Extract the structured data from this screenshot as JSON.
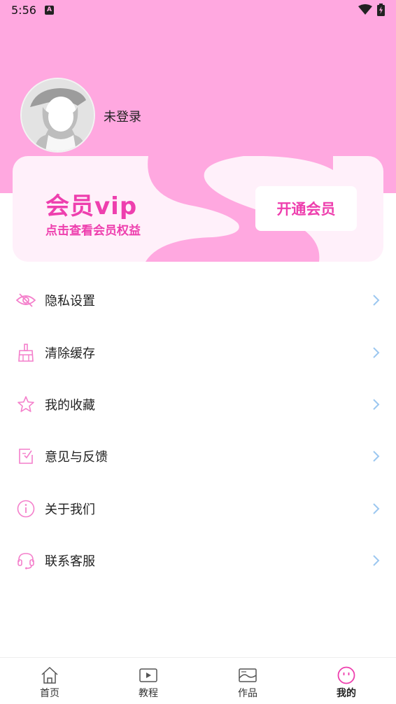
{
  "status_bar": {
    "time": "5:56",
    "notification_letter": "A"
  },
  "profile": {
    "login_status": "未登录"
  },
  "vip_card": {
    "title": "会员vip",
    "subtitle": "点击查看会员权益",
    "button_label": "开通会员"
  },
  "menu": {
    "items": [
      {
        "label": "隐私设置",
        "icon": "eye-icon"
      },
      {
        "label": "清除缓存",
        "icon": "broom-icon"
      },
      {
        "label": "我的收藏",
        "icon": "star-icon"
      },
      {
        "label": "意见与反馈",
        "icon": "feedback-icon"
      },
      {
        "label": "关于我们",
        "icon": "info-icon"
      },
      {
        "label": "联系客服",
        "icon": "headset-icon"
      }
    ]
  },
  "tabs": [
    {
      "label": "首页",
      "icon": "home-icon",
      "active": false
    },
    {
      "label": "教程",
      "icon": "play-icon",
      "active": false
    },
    {
      "label": "作品",
      "icon": "gallery-icon",
      "active": false
    },
    {
      "label": "我的",
      "icon": "smiley-icon",
      "active": true
    }
  ],
  "colors": {
    "header": "#ffa8e0",
    "accent": "#ee3fae",
    "icon_pink": "#f47fcb",
    "arrow": "#9cc7f0",
    "card_bg": "#fff0fa"
  }
}
